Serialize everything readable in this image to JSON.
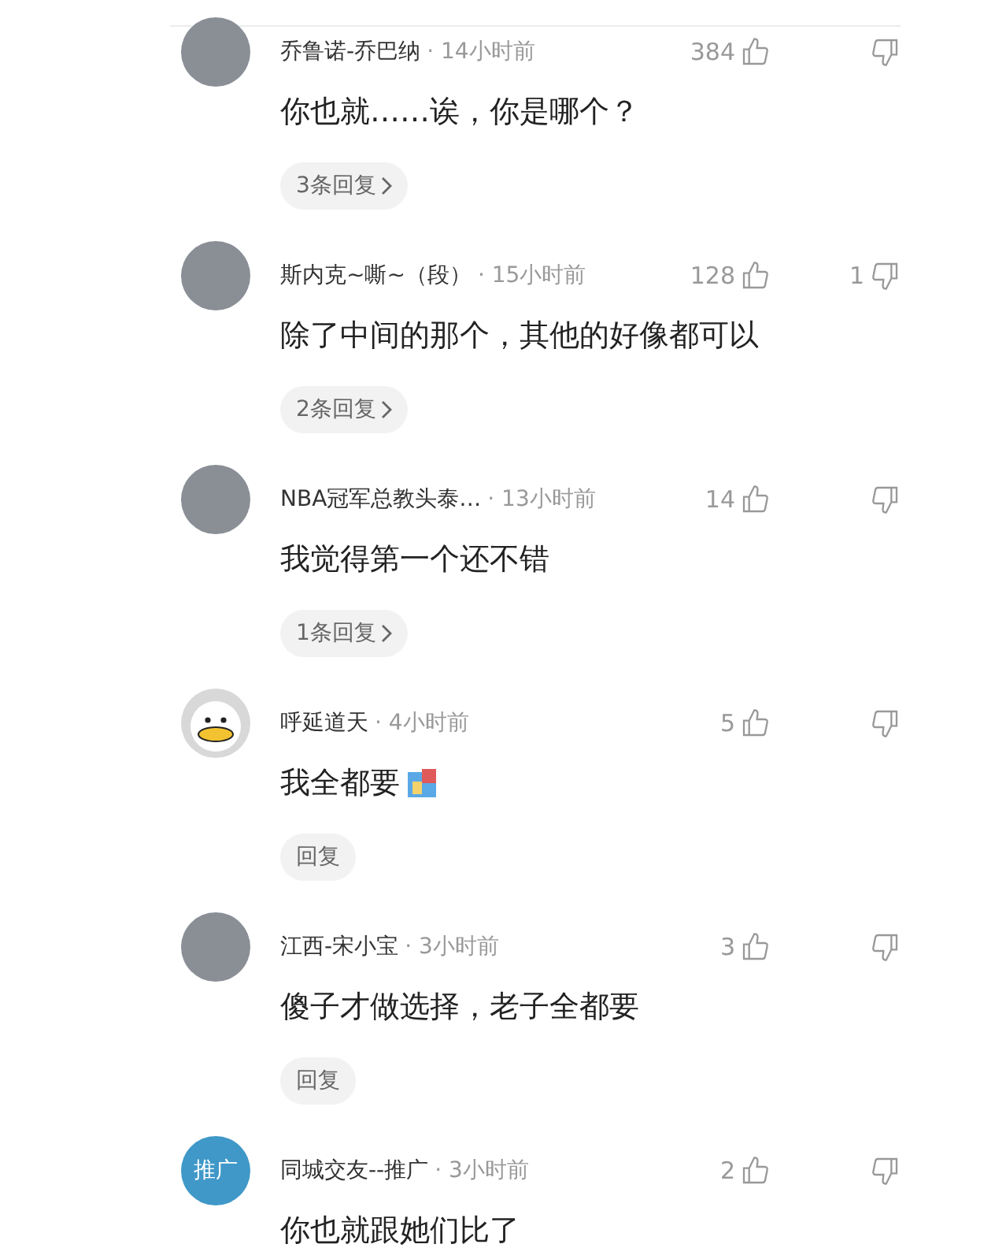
{
  "comments": [
    {
      "avatar": {
        "kind": "photo"
      },
      "user": "乔鲁诺-乔巴纳",
      "time": "· 14小时前",
      "likes": "384",
      "text": "你也就……诶，你是哪个？",
      "sticker": false,
      "replies": "3条回复",
      "reply_arrow": true
    },
    {
      "avatar": {
        "kind": "photo"
      },
      "user": "斯内克~嘶~（段）",
      "time": "· 15小时前",
      "likes": "128",
      "dislikes": "1",
      "text": "除了中间的那个，其他的好像都可以",
      "sticker": false,
      "replies": "2条回复",
      "reply_arrow": true
    },
    {
      "avatar": {
        "kind": "photo"
      },
      "user": "NBA冠军总教头泰…",
      "time": "· 13小时前",
      "likes": "14",
      "text": "我觉得第一个还不错",
      "sticker": false,
      "replies": "1条回复",
      "reply_arrow": true
    },
    {
      "avatar": {
        "kind": "cartoon"
      },
      "user": "呼延道天",
      "time": "· 4小时前",
      "likes": "5",
      "text": "我全都要",
      "sticker": true,
      "replies": "回复",
      "reply_arrow": false
    },
    {
      "avatar": {
        "kind": "photo"
      },
      "user": "江西-宋小宝",
      "time": "· 3小时前",
      "likes": "3",
      "text": "傻子才做选择，老子全都要",
      "sticker": false,
      "replies": "回复",
      "reply_arrow": false
    },
    {
      "avatar": {
        "kind": "badge",
        "text": "推广"
      },
      "user": "同城交友--推广",
      "time": "· 3小时前",
      "likes": "2",
      "text": "你也就跟她们比了",
      "sticker": false
    }
  ]
}
